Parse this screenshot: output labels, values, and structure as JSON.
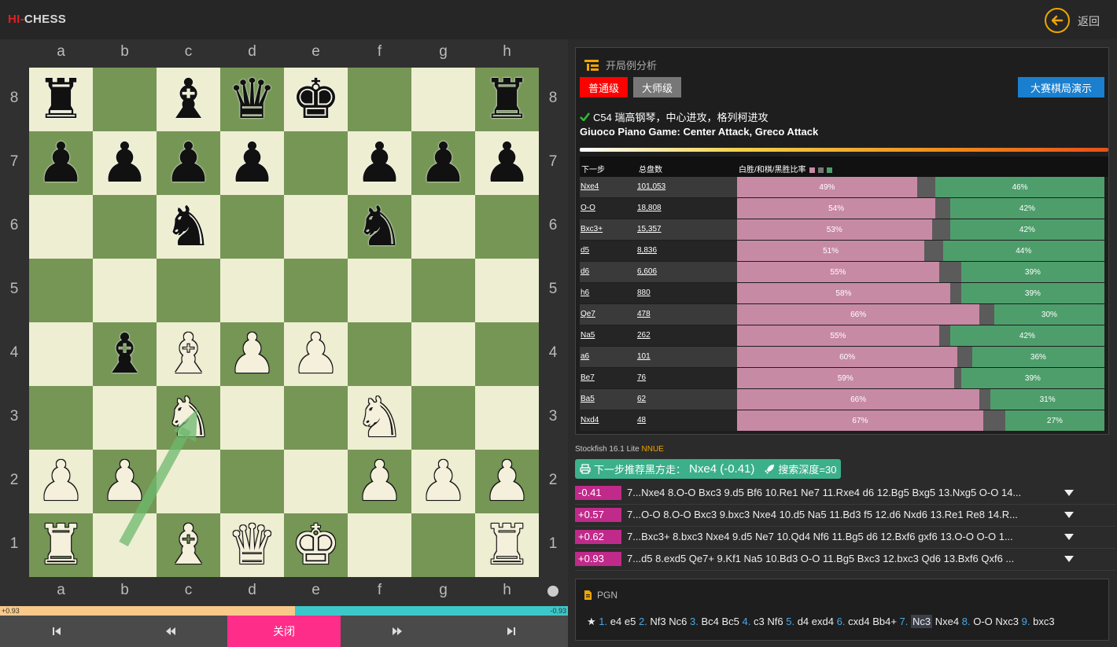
{
  "app": {
    "logo_hi": "HI-",
    "logo_chess": "CHESS",
    "back_label": "返回"
  },
  "board": {
    "files": [
      "a",
      "b",
      "c",
      "d",
      "e",
      "f",
      "g",
      "h"
    ],
    "ranks": [
      "8",
      "7",
      "6",
      "5",
      "4",
      "3",
      "2",
      "1"
    ],
    "pieces": [
      [
        "r",
        "",
        "b",
        "q",
        "k",
        "",
        "",
        "r"
      ],
      [
        "p",
        "p",
        "p",
        "p",
        "",
        "p",
        "p",
        "p"
      ],
      [
        "",
        "",
        "n",
        "",
        "",
        "n",
        "",
        ""
      ],
      [
        "",
        "",
        "",
        "",
        "",
        "",
        "",
        ""
      ],
      [
        "",
        "b",
        "B",
        "P",
        "P",
        "",
        "",
        ""
      ],
      [
        "",
        "",
        "N",
        "",
        "",
        "N",
        "",
        ""
      ],
      [
        "P",
        "P",
        "",
        "",
        "",
        "P",
        "P",
        "P"
      ],
      [
        "R",
        "",
        "B",
        "Q",
        "K",
        "",
        "",
        "R"
      ]
    ]
  },
  "eval": {
    "white_value": "+0.93",
    "black_value": "-0.93",
    "white_fraction": 0.52
  },
  "controls": {
    "first": "first",
    "prev": "prev",
    "close": "关闭",
    "next": "next",
    "last": "last"
  },
  "opening": {
    "title": "开局例分析",
    "btn_normal": "普通级",
    "btn_master": "大师级",
    "btn_demo": "大赛棋局演示",
    "name_cn": "C54 瑞高钢琴，中心进攻，格列柯进攻",
    "name_en": "Giuoco Piano Game: Center Attack, Greco Attack",
    "col_move": "下一步",
    "col_count": "总盘数",
    "col_ratio": "白胜/和棋/黑胜比率",
    "colors": {
      "white": "#c78aa4",
      "draw": "#5b5b5b",
      "black": "#4e9e6c"
    },
    "rows": [
      {
        "move": "Nxe4",
        "count": "101,053",
        "w": 49,
        "d": 5,
        "b": 46,
        "w_label": "49%",
        "b_label": "46%"
      },
      {
        "move": "O-O",
        "count": "18,808",
        "w": 54,
        "d": 4,
        "b": 42,
        "w_label": "54%",
        "b_label": "42%"
      },
      {
        "move": "Bxc3+",
        "count": "15,357",
        "w": 53,
        "d": 5,
        "b": 42,
        "w_label": "53%",
        "b_label": "42%"
      },
      {
        "move": "d5",
        "count": "8,836",
        "w": 51,
        "d": 5,
        "b": 44,
        "w_label": "51%",
        "b_label": "44%"
      },
      {
        "move": "d6",
        "count": "6,606",
        "w": 55,
        "d": 6,
        "b": 39,
        "w_label": "55%",
        "b_label": "39%"
      },
      {
        "move": "h6",
        "count": "880",
        "w": 58,
        "d": 3,
        "b": 39,
        "w_label": "58%",
        "b_label": "39%"
      },
      {
        "move": "Qe7",
        "count": "478",
        "w": 66,
        "d": 4,
        "b": 30,
        "w_label": "66%",
        "b_label": "30%"
      },
      {
        "move": "Na5",
        "count": "262",
        "w": 55,
        "d": 3,
        "b": 42,
        "w_label": "55%",
        "b_label": "42%"
      },
      {
        "move": "a6",
        "count": "101",
        "w": 60,
        "d": 4,
        "b": 36,
        "w_label": "60%",
        "b_label": "36%"
      },
      {
        "move": "Be7",
        "count": "76",
        "w": 59,
        "d": 2,
        "b": 39,
        "w_label": "59%",
        "b_label": "39%"
      },
      {
        "move": "Ba5",
        "count": "62",
        "w": 66,
        "d": 3,
        "b": 31,
        "w_label": "66%",
        "b_label": "31%"
      },
      {
        "move": "Nxd4",
        "count": "48",
        "w": 67,
        "d": 6,
        "b": 27,
        "w_label": "67%",
        "b_label": "27%"
      }
    ]
  },
  "engine": {
    "name": "Stockfish 16.1 Lite",
    "nnue": "NNUE",
    "rec_prefix": "下一步推荐黑方走：",
    "rec_move": "Nxe4 (-0.41)",
    "depth": "搜索深度=30",
    "lines": [
      {
        "score": "-0.41",
        "pv": "7...Nxe4 8.O-O Bxc3 9.d5 Bf6 10.Re1 Ne7 11.Rxe4 d6 12.Bg5 Bxg5 13.Nxg5 O-O 14..."
      },
      {
        "score": "+0.57",
        "pv": "7...O-O 8.O-O Bxc3 9.bxc3 Nxe4 10.d5 Na5 11.Bd3 f5 12.d6 Nxd6 13.Re1 Re8 14.R..."
      },
      {
        "score": "+0.62",
        "pv": "7...Bxc3+ 8.bxc3 Nxe4 9.d5 Ne7 10.Qd4 Nf6 11.Bg5 d6 12.Bxf6 gxf6 13.O-O O-O 1..."
      },
      {
        "score": "+0.93",
        "pv": "7...d5 8.exd5 Qe7+ 9.Kf1 Na5 10.Bd3 O-O 11.Bg5 Bxc3 12.bxc3 Qd6 13.Bxf6 Qxf6 ..."
      }
    ]
  },
  "pgn": {
    "title": "PGN",
    "star": "★",
    "moves": [
      {
        "n": "1.",
        "w": "e4",
        "b": "e5"
      },
      {
        "n": "2.",
        "w": "Nf3",
        "b": "Nc6"
      },
      {
        "n": "3.",
        "w": "Bc4",
        "b": "Bc5"
      },
      {
        "n": "4.",
        "w": "c3",
        "b": "Nf6"
      },
      {
        "n": "5.",
        "w": "d4",
        "b": "exd4"
      },
      {
        "n": "6.",
        "w": "cxd4",
        "b": "Bb4+"
      },
      {
        "n": "7.",
        "w": "Nc3",
        "b": "Nxe4",
        "current": "w"
      },
      {
        "n": "8.",
        "w": "O-O",
        "b": "Nxc3"
      },
      {
        "n": "9.",
        "w": "bxc3",
        "b": ""
      }
    ]
  }
}
